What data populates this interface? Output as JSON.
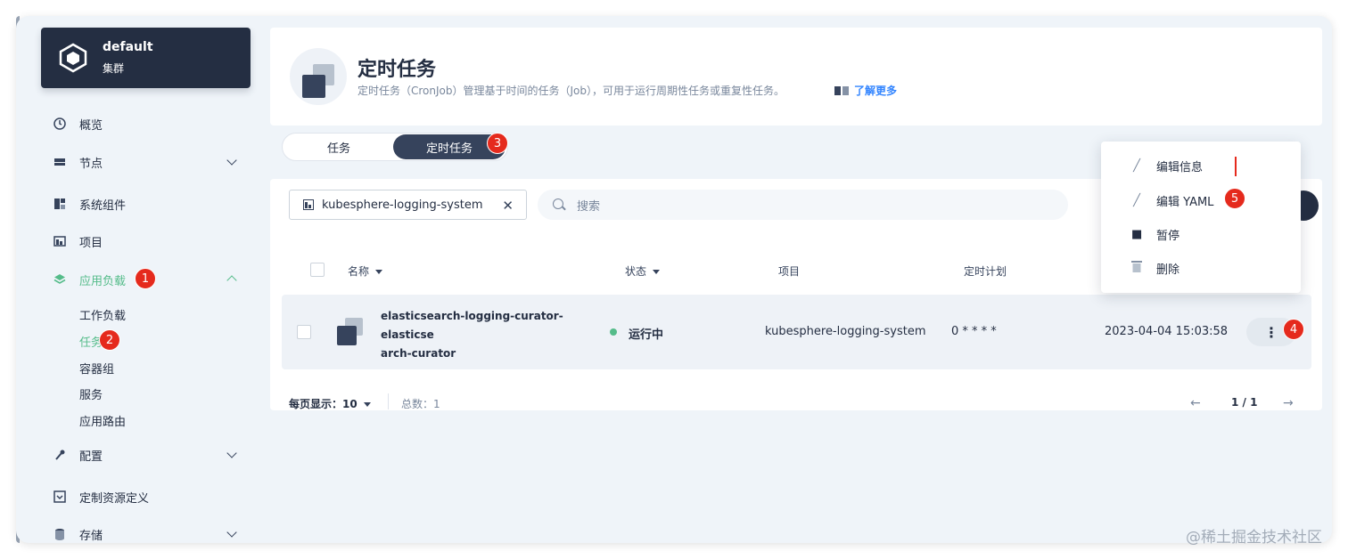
{
  "sidebar": {
    "cluster": {
      "name": "default",
      "sub": "集群"
    },
    "items": [
      {
        "label": "概览"
      },
      {
        "label": "节点"
      },
      {
        "label": "系统组件"
      },
      {
        "label": "项目"
      },
      {
        "label": "应用负载"
      },
      {
        "label": "配置"
      },
      {
        "label": "定制资源定义"
      },
      {
        "label": "存储"
      }
    ],
    "sub_items": [
      "工作负载",
      "任务",
      "容器组",
      "服务",
      "应用路由"
    ]
  },
  "header": {
    "title": "定时任务",
    "description": "定时任务（CronJob）管理基于时间的任务（Job），可用于运行周期性任务或重复性任务。",
    "learn_more": "了解更多"
  },
  "tabs": [
    "任务",
    "定时任务"
  ],
  "filter": {
    "namespace": "kubesphere-logging-system",
    "search_placeholder": "搜索"
  },
  "table": {
    "columns": [
      "名称",
      "状态",
      "项目",
      "定时计划"
    ],
    "rows": [
      {
        "name_line1": "elasticsearch-logging-curator-elasticse",
        "name_line2": "arch-curator",
        "desc": "-",
        "status": "运行中",
        "project": "kubesphere-logging-system",
        "schedule": "0 * * * *",
        "time": "2023-04-04 15:03:58",
        "more": "⋮"
      }
    ]
  },
  "footer": {
    "per_page_label": "每页显示：",
    "per_page": "10",
    "total": "总数：1",
    "page": "1 / 1",
    "prev": "←",
    "next": "→"
  },
  "menu": [
    "编辑信息",
    "编辑 YAML",
    "暂停",
    "删除"
  ],
  "badges": [
    "1",
    "2",
    "3",
    "4",
    "5"
  ],
  "watermark": "@稀土掘金技术社区",
  "colors": {
    "accent": "#55bc8a",
    "dark": "#242e42",
    "badge": "#e52a1d",
    "link": "#3385ff"
  }
}
